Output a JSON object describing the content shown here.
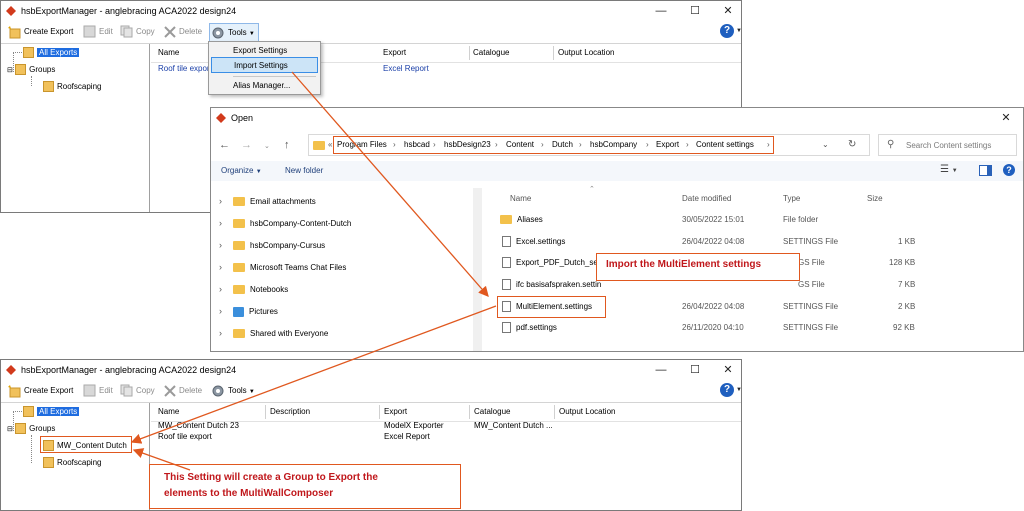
{
  "colors": {
    "accent": "#e0581f",
    "selection": "#1e6ce0",
    "callout_text": "#c0171b",
    "link_blue": "#1a3fa8"
  },
  "window1": {
    "title": "hsbExportManager - anglebracing ACA2022 design24",
    "toolbar": {
      "create": "Create Export",
      "edit": "Edit",
      "copy": "Copy",
      "delete": "Delete",
      "tools": "Tools"
    },
    "tree": {
      "all_exports": "All Exports",
      "groups": "Groups",
      "roofscaping": "Roofscaping"
    },
    "columns": [
      "Name",
      "Export",
      "Catalogue",
      "Output Location"
    ],
    "rows": [
      {
        "name": "Roof tile export",
        "export": "Excel Report"
      }
    ],
    "tools_menu": {
      "items": [
        "Export Settings",
        "Import Settings",
        "Alias Manager..."
      ]
    }
  },
  "dialog": {
    "title": "Open",
    "breadcrumb": [
      "Program Files",
      "hsbcad",
      "hsbDesign23",
      "Content",
      "Dutch",
      "hsbCompany",
      "Export",
      "Content settings"
    ],
    "search_placeholder": "Search Content settings",
    "commands": {
      "organize": "Organize",
      "new_folder": "New folder"
    },
    "nav": [
      "Email attachments",
      "hsbCompany-Content-Dutch",
      "hsbCompany-Cursus",
      "Microsoft Teams Chat Files",
      "Notebooks",
      "Pictures",
      "Shared with Everyone"
    ],
    "file_columns": [
      "Name",
      "Date modified",
      "Type",
      "Size"
    ],
    "files": [
      {
        "name": "Aliases",
        "date": "30/05/2022 15:01",
        "type": "File folder",
        "size": ""
      },
      {
        "name": "Excel.settings",
        "date": "26/04/2022 04:08",
        "type": "SETTINGS File",
        "size": "1 KB"
      },
      {
        "name": "Export_PDF_Dutch_set",
        "date": "",
        "type": "GS File",
        "size": "128 KB"
      },
      {
        "name": "ifc basisafspraken.settin",
        "date": "",
        "type": "GS File",
        "size": "7 KB"
      },
      {
        "name": "MultiElement.settings",
        "date": "26/04/2022 04:08",
        "type": "SETTINGS File",
        "size": "2 KB"
      },
      {
        "name": "pdf.settings",
        "date": "26/11/2020 04:10",
        "type": "SETTINGS File",
        "size": "92 KB"
      }
    ]
  },
  "window2": {
    "title": "hsbExportManager - anglebracing ACA2022 design24",
    "toolbar": {
      "create": "Create Export",
      "edit": "Edit",
      "copy": "Copy",
      "delete": "Delete",
      "tools": "Tools"
    },
    "tree": {
      "all_exports": "All Exports",
      "groups": "Groups",
      "mw": "MW_Content Dutch",
      "roofscaping": "Roofscaping"
    },
    "columns": [
      "Name",
      "Description",
      "Export",
      "Catalogue",
      "Output Location"
    ],
    "rows": [
      {
        "name": "MW_Content Dutch 23",
        "export": "ModelX Exporter",
        "catalogue": "MW_Content Dutch ..."
      },
      {
        "name": "Roof tile export",
        "export": "Excel Report",
        "catalogue": ""
      }
    ]
  },
  "callouts": {
    "import": "Import the MultiElement settings",
    "group_line1": "This Setting will create a Group to Export the",
    "group_line2": "elements to the MultiWallComposer"
  }
}
